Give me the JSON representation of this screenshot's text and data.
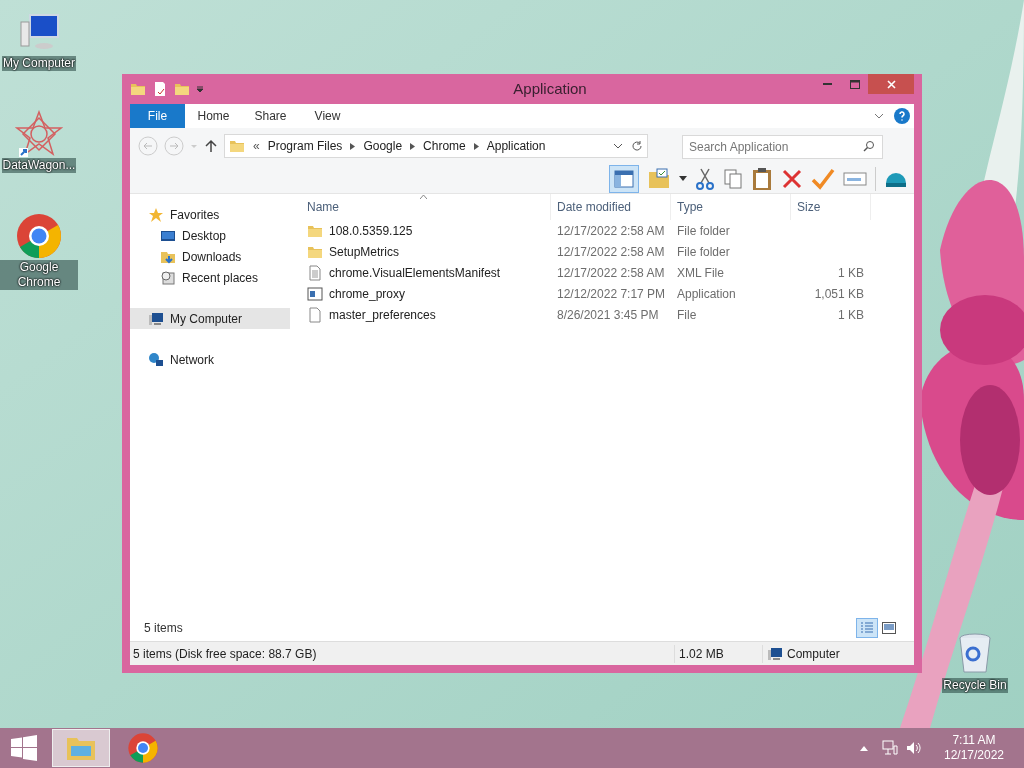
{
  "desktop_icons": [
    {
      "label": "My Computer",
      "kind": "computer"
    },
    {
      "label": "DataWagon...",
      "kind": "star"
    },
    {
      "label": "Google Chrome",
      "kind": "chrome"
    },
    {
      "label": "Recycle Bin",
      "kind": "bin"
    }
  ],
  "window": {
    "title": "Application",
    "ribbon_tabs": [
      {
        "label": "File",
        "kind": "file"
      },
      {
        "label": "Home",
        "kind": "tab"
      },
      {
        "label": "Share",
        "kind": "tab"
      },
      {
        "label": "View",
        "kind": "tab"
      }
    ],
    "address": {
      "overflow": "«",
      "crumbs": [
        "Program Files",
        "Google",
        "Chrome",
        "Application"
      ]
    },
    "search": {
      "placeholder": "Search Application"
    },
    "nav": [
      {
        "label": "Favorites",
        "kind": "star",
        "selected": false,
        "children": [
          {
            "label": "Desktop",
            "kind": "desktop",
            "selected": false
          },
          {
            "label": "Downloads",
            "kind": "downloads",
            "selected": false
          },
          {
            "label": "Recent places",
            "kind": "recent",
            "selected": false
          }
        ]
      },
      {
        "label": "My Computer",
        "kind": "computer",
        "selected": true
      },
      {
        "label": "Network",
        "kind": "network",
        "selected": false
      }
    ],
    "table": {
      "columns": [
        {
          "label": "Name",
          "sorted": true
        },
        {
          "label": "Date modified",
          "sorted": false
        },
        {
          "label": "Type",
          "sorted": false
        },
        {
          "label": "Size",
          "sorted": false
        }
      ],
      "rows": [
        {
          "kind": "folder",
          "name": "108.0.5359.125",
          "date": "12/17/2022 2:58 AM",
          "type": "File folder"
        },
        {
          "kind": "folder",
          "name": "SetupMetrics",
          "date": "12/17/2022 2:58 AM",
          "type": "File folder"
        },
        {
          "kind": "xml",
          "name": "chrome.VisualElementsManifest",
          "date": "12/17/2022 2:58 AM",
          "type": "XML File",
          "size": "1 KB"
        },
        {
          "kind": "app",
          "name": "chrome_proxy",
          "date": "12/12/2022 7:17 PM",
          "type": "Application",
          "size": "1,051 KB"
        },
        {
          "kind": "file",
          "name": "master_preferences",
          "date": "8/26/2021 3:45 PM",
          "type": "File",
          "size": "1 KB"
        }
      ]
    },
    "item_count": "5 items",
    "views": [
      {
        "kind": "details",
        "selected": true
      },
      {
        "kind": "tiles",
        "selected": false
      }
    ],
    "status_bar": {
      "summary": "5 items (Disk free space: 88.7 GB)",
      "size": "1.02 MB",
      "location": "Computer"
    }
  },
  "taskbar": {
    "apps": [
      {
        "kind": "explorer",
        "selected": true
      },
      {
        "kind": "chrome",
        "selected": false
      }
    ],
    "time": "7:11 AM",
    "date": "12/17/2022"
  }
}
